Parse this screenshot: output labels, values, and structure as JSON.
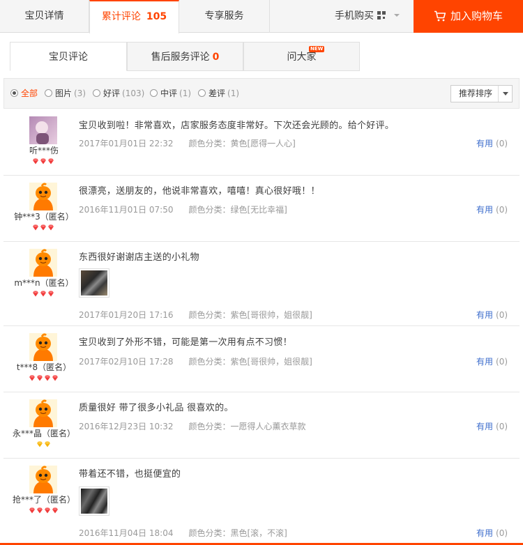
{
  "topbar": {
    "tab_details": "宝贝详情",
    "tab_reviews_label": "累计评论",
    "tab_reviews_count": "105",
    "tab_service": "专享服务",
    "mobile_buy": "手机购买",
    "add_to_cart": "加入购物车"
  },
  "subtabs": {
    "product_reviews": "宝贝评论",
    "after_sale_label": "售后服务评论",
    "after_sale_count": "0",
    "ask_all": "问大家",
    "new_badge": "NEW"
  },
  "filters": [
    {
      "label": "全部",
      "count": "",
      "active": true
    },
    {
      "label": "图片",
      "count": "(3)",
      "active": false
    },
    {
      "label": "好评",
      "count": "(103)",
      "active": false
    },
    {
      "label": "中评",
      "count": "(1)",
      "active": false
    },
    {
      "label": "差评",
      "count": "(1)",
      "active": false
    }
  ],
  "sort": {
    "selected": "推荐排序"
  },
  "useful_label": "有用",
  "colors": {
    "accent": "#ff4400",
    "link": "#3d6dcc",
    "muted": "#999999"
  },
  "reviews": [
    {
      "user": "听***伤",
      "level": 3,
      "level_type": "red",
      "avatar": "photo",
      "text": "宝贝收到啦！非常喜欢，店家服务态度非常好。下次还会光顾的。给个好评。",
      "date": "2017年01月01日 22:32",
      "sku": "颜色分类：黄色[愿得一人心]",
      "useful": "(0)",
      "has_photo": false
    },
    {
      "user": "钟***3（匿名）",
      "level": 3,
      "level_type": "red",
      "avatar": "mascot",
      "text": "很漂亮，送朋友的，他说非常喜欢，嘻嘻！真心很好哦！！",
      "date": "2016年11月01日 07:50",
      "sku": "颜色分类：绿色[无比幸福]",
      "useful": "(0)",
      "has_photo": false
    },
    {
      "user": "m***n（匿名）",
      "level": 3,
      "level_type": "red",
      "avatar": "mascot",
      "text": "东西很好谢谢店主送的小礼物",
      "date": "2017年01月20日 17:16",
      "sku": "颜色分类：紫色[哥很帅，姐很靓]",
      "useful": "(0)",
      "has_photo": true
    },
    {
      "user": "t***8（匿名）",
      "level": 4,
      "level_type": "red",
      "avatar": "mascot",
      "text": "宝贝收到了外形不错，可能是第一次用有点不习惯！",
      "date": "2017年02月10日 17:28",
      "sku": "颜色分类：紫色[哥很帅，姐很靓]",
      "useful": "(0)",
      "has_photo": false
    },
    {
      "user": "永***晶（匿名）",
      "level": 2,
      "level_type": "yellow",
      "avatar": "mascot",
      "text": "质量很好 带了很多小礼品 很喜欢的。",
      "date": "2016年12月23日 10:32",
      "sku": "颜色分类：一愿得人心薰衣草款",
      "useful": "(0)",
      "has_photo": false
    },
    {
      "user": "抢***了（匿名）",
      "level": 4,
      "level_type": "red",
      "avatar": "mascot",
      "text": "带着还不错，也挺便宜的",
      "date": "2016年11月04日 18:04",
      "sku": "颜色分类：黑色[滚，不滚]",
      "useful": "(0)",
      "has_photo": true
    }
  ]
}
